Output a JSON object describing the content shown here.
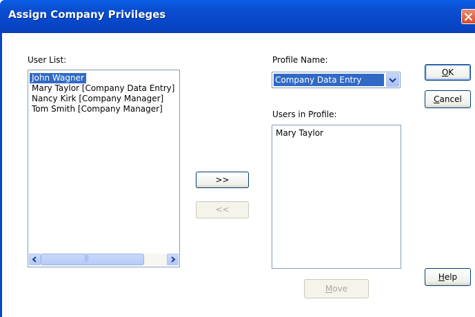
{
  "window": {
    "title": "Assign Company Privileges"
  },
  "user_list": {
    "label": "User List:",
    "items": [
      {
        "text": "John Wagner",
        "selected": true
      },
      {
        "text": "Mary Taylor [Company Data Entry]",
        "selected": false
      },
      {
        "text": "Nancy Kirk [Company Manager]",
        "selected": false
      },
      {
        "text": "Tom Smith [Company Manager]",
        "selected": false
      }
    ],
    "scrollbar": {
      "grip": "|||"
    }
  },
  "transfer": {
    "add_label": ">>",
    "remove_label": "<<"
  },
  "profile": {
    "label": "Profile Name:",
    "selected": "Company Data Entry"
  },
  "users_in_profile": {
    "label": "Users in Profile:",
    "items": [
      "Mary Taylor"
    ]
  },
  "buttons": {
    "ok_pre": "",
    "ok_mnemonic": "O",
    "ok_post": "K",
    "cancel_pre": "",
    "cancel_mnemonic": "C",
    "cancel_post": "ancel",
    "help_pre": "",
    "help_mnemonic": "H",
    "help_post": "elp",
    "move_pre": "",
    "move_mnemonic": "M",
    "move_post": "ove"
  },
  "colors": {
    "titlebar": "#0a4ed0",
    "selection": "#316ac5",
    "border": "#7f9db9"
  },
  "icons": {
    "close": "close-icon",
    "dropdown": "chevron-down-icon",
    "scroll_left": "arrow-left-icon",
    "scroll_right": "arrow-right-icon"
  }
}
